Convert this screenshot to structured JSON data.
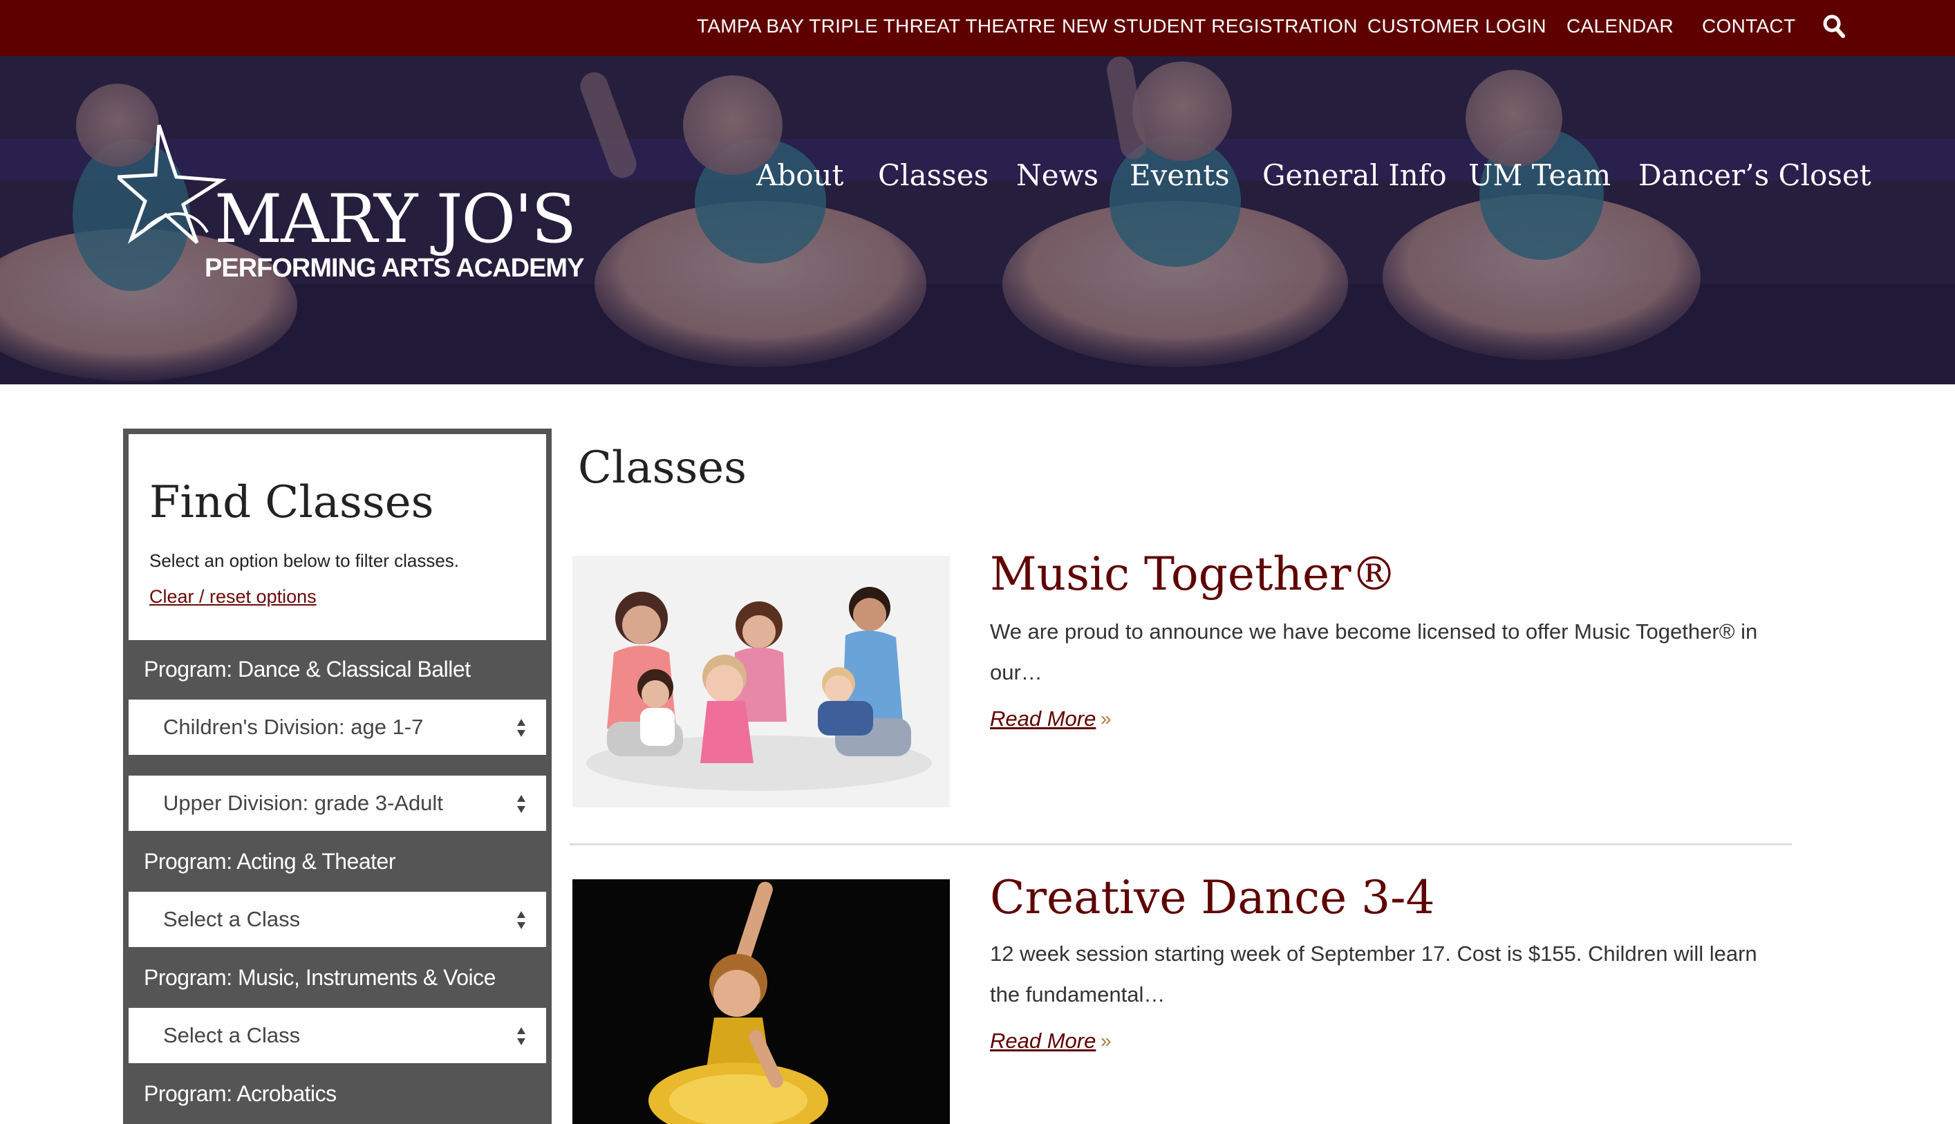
{
  "topbar": {
    "links": [
      {
        "label": "TAMPA BAY TRIPLE THREAT THEATRE"
      },
      {
        "label": "NEW STUDENT REGISTRATION"
      },
      {
        "label": "CUSTOMER LOGIN"
      },
      {
        "label": "CALENDAR"
      },
      {
        "label": "CONTACT"
      }
    ],
    "search_icon": "search-icon"
  },
  "header": {
    "logo": {
      "line1": "MARY JO'S",
      "line2": "PERFORMING ARTS ACADEMY"
    },
    "nav": [
      {
        "label": "About"
      },
      {
        "label": "Classes"
      },
      {
        "label": "News"
      },
      {
        "label": "Events"
      },
      {
        "label": "General Info"
      },
      {
        "label": "UM Team"
      },
      {
        "label": "Dancer’s Closet"
      }
    ]
  },
  "sidebar": {
    "title": "Find Classes",
    "subtitle": "Select an option below to filter classes.",
    "reset_label": "Clear / reset options",
    "programs": [
      {
        "label": "Program: Dance & Classical Ballet",
        "selects": [
          "Children's Division: age 1-7",
          "Upper Division: grade 3-Adult"
        ]
      },
      {
        "label": "Program: Acting & Theater",
        "selects": [
          "Select a Class"
        ]
      },
      {
        "label": "Program: Music, Instruments & Voice",
        "selects": [
          "Select a Class"
        ]
      },
      {
        "label": "Program: Acrobatics",
        "selects": []
      }
    ]
  },
  "main": {
    "title": "Classes",
    "items": [
      {
        "title": "Music Together®",
        "excerpt": "  We are proud to announce we have become licensed to offer Music Together® in our…",
        "read_more": "Read More",
        "arrow": "»"
      },
      {
        "title": "Creative Dance 3-4",
        "excerpt": "12 week session starting week of September 17. Cost is $155. Children will learn the fundamental…",
        "read_more": "Read More",
        "arrow": "»"
      }
    ]
  },
  "colors": {
    "brand": "#5f0000",
    "sidebar": "#555555",
    "accent_arrow": "#b07a3a"
  }
}
